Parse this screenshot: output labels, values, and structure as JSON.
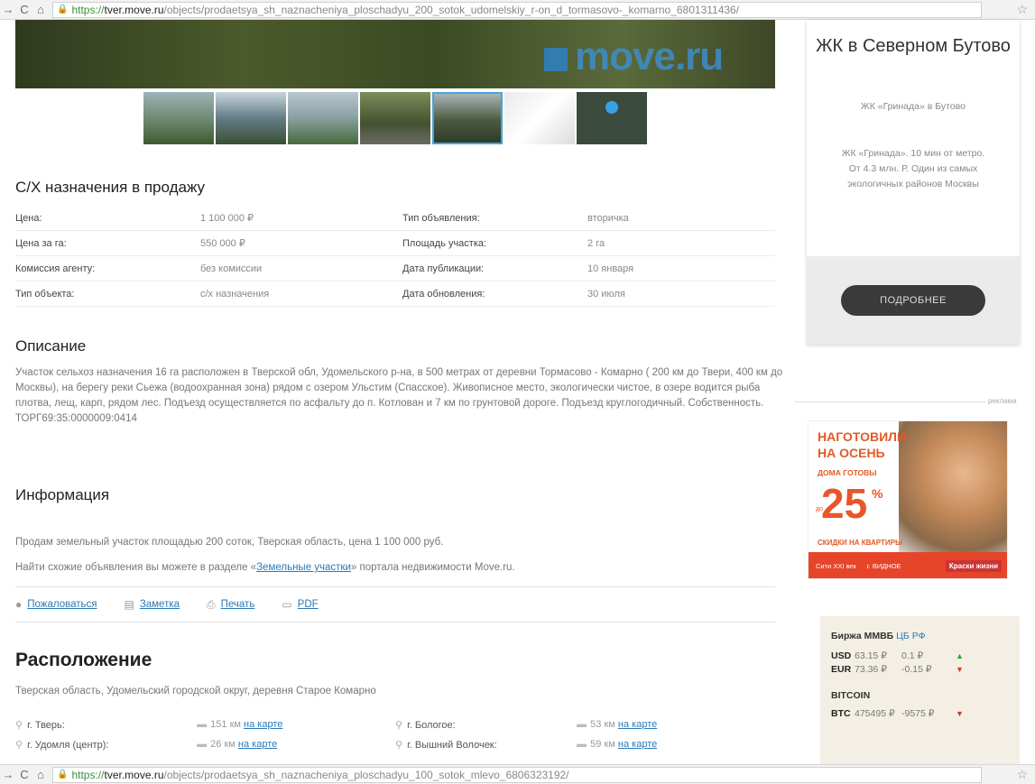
{
  "browser": {
    "top": {
      "url_proto": "https://",
      "url_host": "tver.move.ru",
      "url_path": "/objects/prodaetsya_sh_naznacheniya_ploschadyu_200_sotok_udomelskiy_r-on_d_tormasovo-_komarno_6801311436/"
    },
    "bottom": {
      "url_proto": "https://",
      "url_host": "tver.move.ru",
      "url_path": "/objects/prodaetsya_sh_naznacheniya_ploschadyu_100_sotok_mlevo_6806323192/"
    }
  },
  "hero": {
    "logo": "move.ru"
  },
  "listing": {
    "title": "С/Х назначения в продажу",
    "props": [
      {
        "l1": "Цена:",
        "v1": "1 100 000 ₽",
        "l2": "Тип объявления:",
        "v2": "вторичка"
      },
      {
        "l1": "Цена за га:",
        "v1": "550 000 ₽",
        "l2": "Площадь участка:",
        "v2": "2 га"
      },
      {
        "l1": "Комиссия агенту:",
        "v1": "без комиссии",
        "l2": "Дата публикации:",
        "v2": "10 января"
      },
      {
        "l1": "Тип объекта:",
        "v1": "с/х назначения",
        "l2": "Дата обновления:",
        "v2": "30 июля"
      }
    ],
    "description_title": "Описание",
    "description": "Участок сельхоз назначения 16 га расположен в Тверской обл, Удомельского р-на, в 500 метрах от деревни Тормасово - Комарно ( 200 км до Твери, 400 км до Москвы), на берегу реки Сьежа (водоохранная зона) рядом с озером Ульстим (Спасское). Живописное место, экологически чистое, в озере водится рыба плотва, лещ, карп, рядом лес. Подъезд осуществляется по асфальту до п. Котлован и 7 км по грунтовой дороге. Подъезд круглогодичный. Собственность. ТОРГ69:35:0000009:0414",
    "info_title": "Информация",
    "info_line1": "Продам земельный участок площадью 200 соток, Тверская область, цена 1 100 000 руб.",
    "info_line2_pre": "Найти схожие объявления вы можете в разделе «",
    "info_line2_link": "Земельные участки",
    "info_line2_post": "» портала недвижимости Move.ru.",
    "actions": [
      {
        "icon": "warning-icon",
        "label": "Пожаловаться"
      },
      {
        "icon": "note-icon",
        "label": "Заметка"
      },
      {
        "icon": "print-icon",
        "label": "Печать"
      },
      {
        "icon": "pdf-icon",
        "label": "PDF"
      }
    ],
    "location_title": "Расположение",
    "location_address": "Тверская область, Удомельский городской округ, деревня Старое Комарно",
    "distances": [
      {
        "city1": "г. Тверь:",
        "d1": "151 км",
        "city2": "г. Бологое:",
        "d2": "53 км"
      },
      {
        "city1": "г. Удомля (центр):",
        "d1": "26 км",
        "city2": "г. Вышний Волочек:",
        "d2": "59 км"
      }
    ],
    "map_link": "на карте"
  },
  "side_card": {
    "title": "ЖК в Северном Бутово",
    "subtitle": "ЖК «Гринада» в Бутово",
    "text": "ЖК «Гринада». 10 мин от метро. От 4.3 млн. Р. Один из самых экологичных районов Москвы",
    "button": "ПОДРОБНЕЕ"
  },
  "ad": {
    "label": "реклама",
    "headline": "НАГОТОВИЛИ НА ОСЕНЬ",
    "sub": "ДОМА ГОТОВЫ",
    "prefix": "до",
    "percent": "25",
    "percent_sign": "%",
    "discount": "СКИДКИ НА КВАРТИРЫ",
    "bar_item1": "Сити XXI век",
    "bar_item2": "г. ВИДНОЕ",
    "brand": "Краски жизни"
  },
  "fx": {
    "title": "Биржа ММВБ",
    "cb": "ЦБ РФ",
    "rows": [
      {
        "cur": "USD",
        "val": "63.15 ₽",
        "chg": "0.1 ₽",
        "dir": "up"
      },
      {
        "cur": "EUR",
        "val": "73.36 ₽",
        "chg": "-0.15 ₽",
        "dir": "down"
      }
    ],
    "btc_title": "BITCOIN",
    "btc": {
      "cur": "BTC",
      "val": "475495 ₽",
      "chg": "-9575 ₽",
      "dir": "down"
    }
  }
}
